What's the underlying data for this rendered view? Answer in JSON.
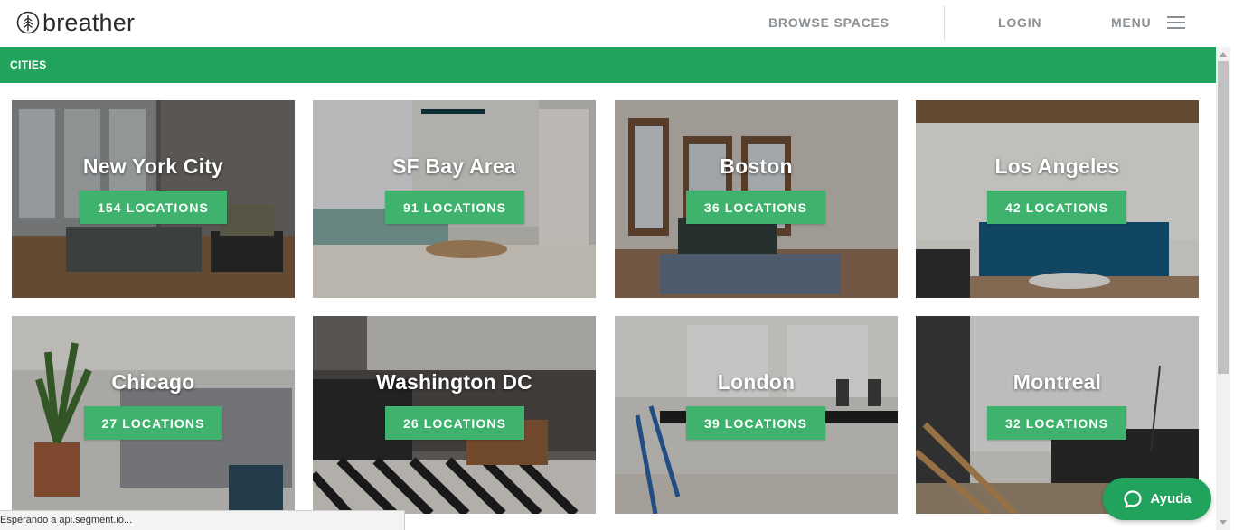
{
  "header": {
    "brand": "breather",
    "nav": {
      "browse": "BROWSE SPACES",
      "login": "LOGIN",
      "menu": "MENU"
    }
  },
  "section": {
    "label": "CITIES"
  },
  "cities": [
    {
      "name": "New York City",
      "locations": "154 LOCATIONS"
    },
    {
      "name": "SF Bay Area",
      "locations": "91 LOCATIONS"
    },
    {
      "name": "Boston",
      "locations": "36 LOCATIONS"
    },
    {
      "name": "Los Angeles",
      "locations": "42 LOCATIONS"
    },
    {
      "name": "Chicago",
      "locations": "27 LOCATIONS"
    },
    {
      "name": "Washington DC",
      "locations": "26 LOCATIONS"
    },
    {
      "name": "London",
      "locations": "39 LOCATIONS"
    },
    {
      "name": "Montreal",
      "locations": "32 LOCATIONS"
    }
  ],
  "status": {
    "text": "Esperando a api.segment.io..."
  },
  "help": {
    "label": "Ayuda"
  },
  "colors": {
    "brand_green": "#21a35d",
    "button_green": "#3fb26d",
    "nav_gray": "#8a8f93"
  },
  "icons": [
    "tree-logo-icon",
    "hamburger-icon",
    "chat-bubble-icon",
    "scroll-up-arrow-icon",
    "scroll-down-arrow-icon"
  ]
}
